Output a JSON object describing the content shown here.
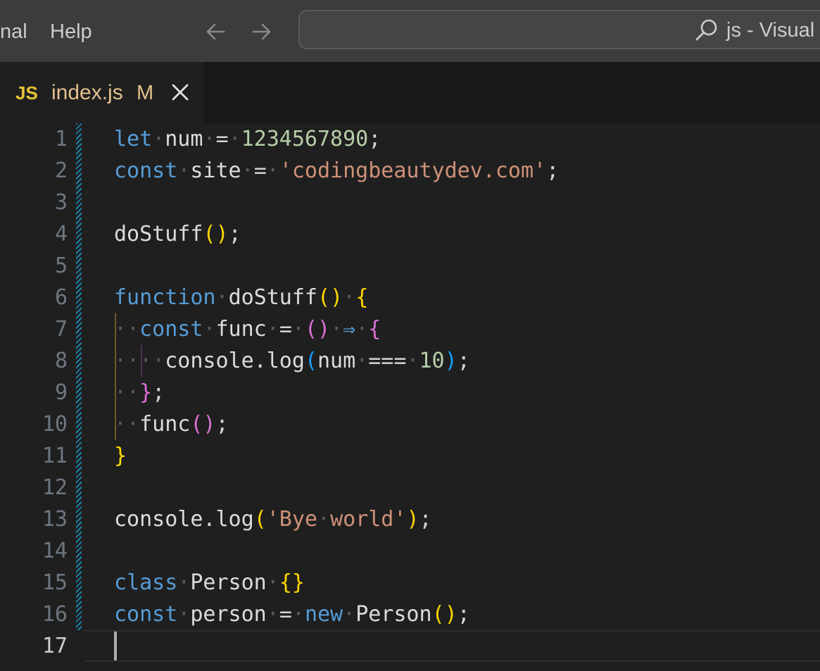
{
  "titlebar": {
    "menu": [
      "nal",
      "Help"
    ],
    "command_center_text": "js - Visual"
  },
  "tab": {
    "lang_badge": "JS",
    "filename": "index.js",
    "status": "M"
  },
  "editor": {
    "line_numbers": [
      "1",
      "2",
      "3",
      "4",
      "5",
      "6",
      "7",
      "8",
      "9",
      "10",
      "11",
      "12",
      "13",
      "14",
      "15",
      "16",
      "17"
    ],
    "active_line": "17",
    "code": [
      [
        [
          "kw",
          "let"
        ],
        [
          "ws",
          "·"
        ],
        [
          "id",
          "num"
        ],
        [
          "ws",
          "·"
        ],
        [
          "pun",
          "="
        ],
        [
          "ws",
          "·"
        ],
        [
          "num",
          "1234567890"
        ],
        [
          "pun",
          ";"
        ]
      ],
      [
        [
          "kw",
          "const"
        ],
        [
          "ws",
          "·"
        ],
        [
          "id",
          "site"
        ],
        [
          "ws",
          "·"
        ],
        [
          "pun",
          "="
        ],
        [
          "ws",
          "·"
        ],
        [
          "str",
          "'codingbeautydev.com'"
        ],
        [
          "pun",
          ";"
        ]
      ],
      [],
      [
        [
          "id",
          "doStuff"
        ],
        [
          "br1",
          "()"
        ],
        [
          "pun",
          ";"
        ]
      ],
      [],
      [
        [
          "kw",
          "function"
        ],
        [
          "ws",
          "·"
        ],
        [
          "id",
          "doStuff"
        ],
        [
          "br1",
          "()"
        ],
        [
          "ws",
          "·"
        ],
        [
          "br1",
          "{"
        ]
      ],
      [
        [
          "ws",
          "··"
        ],
        [
          "kw",
          "const"
        ],
        [
          "ws",
          "·"
        ],
        [
          "id",
          "func"
        ],
        [
          "ws",
          "·"
        ],
        [
          "pun",
          "="
        ],
        [
          "ws",
          "·"
        ],
        [
          "br2",
          "()"
        ],
        [
          "ws",
          "·"
        ],
        [
          "kw",
          "⇒"
        ],
        [
          "ws",
          "·"
        ],
        [
          "br2",
          "{"
        ]
      ],
      [
        [
          "ws",
          "····"
        ],
        [
          "id",
          "console.log"
        ],
        [
          "br3",
          "("
        ],
        [
          "id",
          "num"
        ],
        [
          "ws",
          "·"
        ],
        [
          "pun",
          "==="
        ],
        [
          "ws",
          "·"
        ],
        [
          "num",
          "10"
        ],
        [
          "br3",
          ")"
        ],
        [
          "pun",
          ";"
        ]
      ],
      [
        [
          "ws",
          "··"
        ],
        [
          "br2",
          "}"
        ],
        [
          "pun",
          ";"
        ]
      ],
      [
        [
          "ws",
          "··"
        ],
        [
          "id",
          "func"
        ],
        [
          "br2",
          "()"
        ],
        [
          "pun",
          ";"
        ]
      ],
      [
        [
          "br1",
          "}"
        ]
      ],
      [],
      [
        [
          "id",
          "console.log"
        ],
        [
          "br1",
          "("
        ],
        [
          "str",
          "'Bye"
        ],
        [
          "ws",
          "·"
        ],
        [
          "str",
          "world'"
        ],
        [
          "br1",
          ")"
        ],
        [
          "pun",
          ";"
        ]
      ],
      [],
      [
        [
          "kw",
          "class"
        ],
        [
          "ws",
          "·"
        ],
        [
          "id",
          "Person"
        ],
        [
          "ws",
          "·"
        ],
        [
          "br1",
          "{}"
        ]
      ],
      [
        [
          "kw",
          "const"
        ],
        [
          "ws",
          "·"
        ],
        [
          "id",
          "person"
        ],
        [
          "ws",
          "·"
        ],
        [
          "pun",
          "="
        ],
        [
          "ws",
          "·"
        ],
        [
          "kw",
          "new"
        ],
        [
          "ws",
          "·"
        ],
        [
          "id",
          "Person"
        ],
        [
          "br1",
          "()"
        ],
        [
          "pun",
          ";"
        ]
      ],
      []
    ]
  },
  "colors": {
    "accent_git": "#1b81a8",
    "keyword": "#569cd6",
    "string": "#ce9178",
    "number": "#b5cea8",
    "bracket_gold": "#ffd700",
    "bracket_pink": "#da70d6",
    "bracket_blue": "#179fff"
  },
  "icons": [
    "arrow-left-icon",
    "arrow-right-icon",
    "search-icon",
    "close-icon"
  ]
}
